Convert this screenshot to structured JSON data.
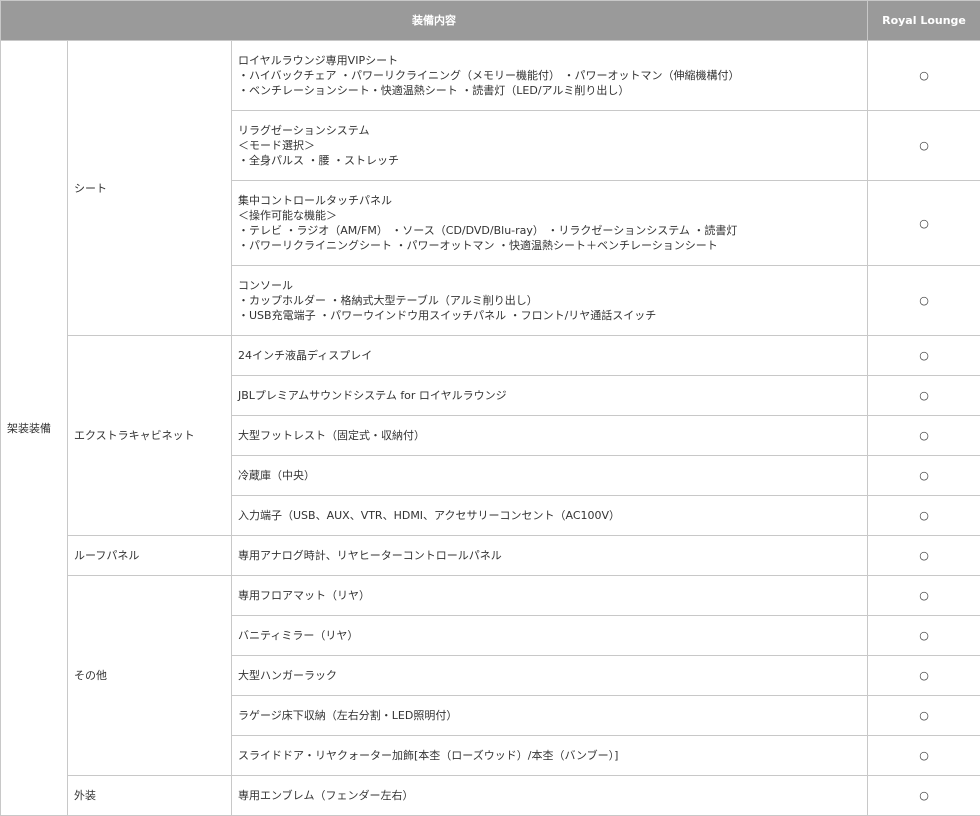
{
  "header": {
    "item_col": "装備内容",
    "grade_col": "Royal Lounge"
  },
  "top_category": "架装装備",
  "groups": [
    {
      "name": "シート",
      "items": [
        {
          "lines": [
            "ロイヤルラウンジ専用VIPシート",
            "・ハイバックチェア ・パワーリクライニング（メモリー機能付） ・パワーオットマン（伸縮機構付）",
            "・ベンチレーションシート・快適温熱シート ・読書灯（LED/アルミ削り出し）"
          ],
          "mark": "○"
        },
        {
          "lines": [
            "リラグゼーションシステム",
            "＜モード選択＞",
            "・全身パルス ・腰 ・ストレッチ"
          ],
          "mark": "○"
        },
        {
          "lines": [
            "集中コントロールタッチパネル",
            "＜操作可能な機能＞",
            "・テレビ ・ラジオ（AM/FM） ・ソース（CD/DVD/Blu-ray） ・リラクゼーションシステム ・読書灯",
            "・パワーリクライニングシート ・パワーオットマン ・快適温熱シート＋ベンチレーションシート"
          ],
          "mark": "○"
        },
        {
          "lines": [
            "コンソール",
            "・カップホルダー ・格納式大型テーブル（アルミ削り出し）",
            "・USB充電端子 ・パワーウインドウ用スイッチパネル ・フロント/リヤ通話スイッチ"
          ],
          "mark": "○"
        }
      ]
    },
    {
      "name": "エクストラキャビネット",
      "items": [
        {
          "lines": [
            "24インチ液晶ディスプレイ"
          ],
          "mark": "○"
        },
        {
          "lines": [
            "JBLプレミアムサウンドシステム for ロイヤルラウンジ"
          ],
          "mark": "○"
        },
        {
          "lines": [
            "大型フットレスト（固定式・収納付）"
          ],
          "mark": "○"
        },
        {
          "lines": [
            "冷蔵庫（中央）"
          ],
          "mark": "○"
        },
        {
          "lines": [
            "入力端子（USB、AUX、VTR、HDMI、アクセサリーコンセント（AC100V）"
          ],
          "mark": "○"
        }
      ]
    },
    {
      "name": "ルーフパネル",
      "items": [
        {
          "lines": [
            "専用アナログ時計、リヤヒーターコントロールパネル"
          ],
          "mark": "○"
        }
      ]
    },
    {
      "name": "その他",
      "items": [
        {
          "lines": [
            "専用フロアマット（リヤ）"
          ],
          "mark": "○"
        },
        {
          "lines": [
            "バニティミラー（リヤ）"
          ],
          "mark": "○"
        },
        {
          "lines": [
            "大型ハンガーラック"
          ],
          "mark": "○"
        },
        {
          "lines": [
            "ラゲージ床下収納（左右分割・LED照明付）"
          ],
          "mark": "○"
        },
        {
          "lines": [
            "スライドドア・リヤクォーター加飾[本杢（ローズウッド）/本杢（バンブー）]"
          ],
          "mark": "○"
        }
      ]
    },
    {
      "name": "外装",
      "items": [
        {
          "lines": [
            "専用エンブレム（フェンダー左右）"
          ],
          "mark": "○"
        }
      ]
    }
  ]
}
